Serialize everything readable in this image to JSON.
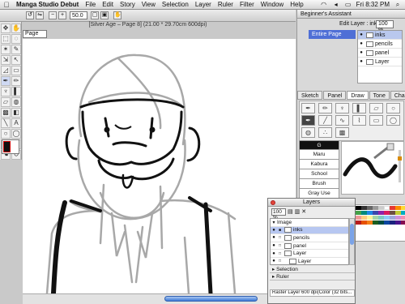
{
  "menubar": {
    "app_name": "Manga Studio Debut",
    "items": [
      "File",
      "Edit",
      "Story",
      "View",
      "Selection",
      "Layer",
      "Ruler",
      "Filter",
      "Window",
      "Help"
    ],
    "clock": "Fri 8:32 PM"
  },
  "document": {
    "title": "[Silver Age – Page 8] (21.00 * 29.70cm 600dpi)",
    "zoom": "50.0",
    "page_tab": "Page"
  },
  "assistant": {
    "title": "Beginner's Assistant",
    "edit_layer_label": "Edit Layer : inks",
    "opacity": "100 %",
    "entire_page": "Entire Page",
    "layers": [
      "inks",
      "pencils",
      "panel",
      "Layer"
    ]
  },
  "tool_tabs": [
    "Sketch",
    "Panel",
    "Draw",
    "Tone",
    "Character"
  ],
  "active_tool_tab": "Draw",
  "brush_presets": [
    "G",
    "Maru",
    "Kabura",
    "School",
    "Brush",
    "Gray Use"
  ],
  "selected_preset": "G",
  "layers_panel": {
    "title": "Layers",
    "opacity": "100 %",
    "group": "Image",
    "layers": [
      "inks",
      "pencils",
      "panel",
      "Layer",
      "Layer"
    ],
    "sections": [
      "Selection",
      "Ruler"
    ],
    "status": "Raster Layer 600 dpi(Color (32 bits..."
  },
  "colors": {
    "selection_blue": "#4f6fd6",
    "black": "#111111",
    "white": "#ffffff"
  }
}
